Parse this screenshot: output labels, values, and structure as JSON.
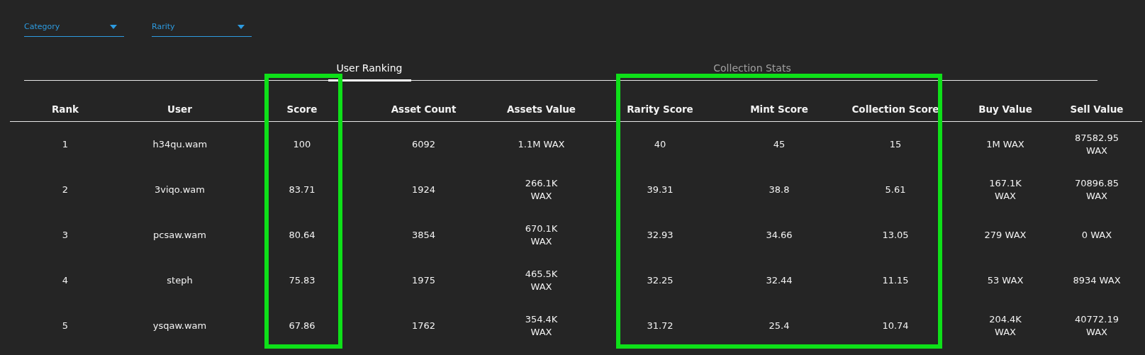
{
  "filters": [
    {
      "label": "Category"
    },
    {
      "label": "Rarity"
    }
  ],
  "tabs": [
    {
      "label": "User Ranking",
      "selected": true
    },
    {
      "label": "Collection Stats",
      "selected": false
    }
  ],
  "table": {
    "columns": [
      {
        "label": "Rank",
        "highlighted": false
      },
      {
        "label": "User",
        "highlighted": false
      },
      {
        "label": "Score",
        "highlighted": true
      },
      {
        "label": "Asset Count",
        "highlighted": false
      },
      {
        "label": "Assets Value",
        "highlighted": false
      },
      {
        "label": "Rarity Score",
        "highlighted": true
      },
      {
        "label": "Mint Score",
        "highlighted": true
      },
      {
        "label": "Collection Score",
        "highlighted": true
      },
      {
        "label": "Buy Value",
        "highlighted": false
      },
      {
        "label": "Sell Value",
        "highlighted": false
      }
    ],
    "rows": [
      [
        "1",
        "h34qu.wam",
        "100",
        "6092",
        "1.1M  WAX",
        "40",
        "45",
        "15",
        "1M  WAX",
        "87582.95 WAX"
      ],
      [
        "2",
        "3viqo.wam",
        "83.71",
        "1924",
        "266.1K  WAX",
        "39.31",
        "38.8",
        "5.61",
        "167.1K  WAX",
        "70896.85 WAX"
      ],
      [
        "3",
        "pcsaw.wam",
        "80.64",
        "3854",
        "670.1K  WAX",
        "32.93",
        "34.66",
        "13.05",
        "279  WAX",
        "0  WAX"
      ],
      [
        "4",
        "steph",
        "75.83",
        "1975",
        "465.5K  WAX",
        "32.25",
        "32.44",
        "11.15",
        "53  WAX",
        "8934 WAX"
      ],
      [
        "5",
        "ysqaw.wam",
        "67.86",
        "1762",
        "354.4K  WAX",
        "31.72",
        "25.4",
        "10.74",
        "204.4K  WAX",
        "40772.19 WAX"
      ]
    ]
  }
}
